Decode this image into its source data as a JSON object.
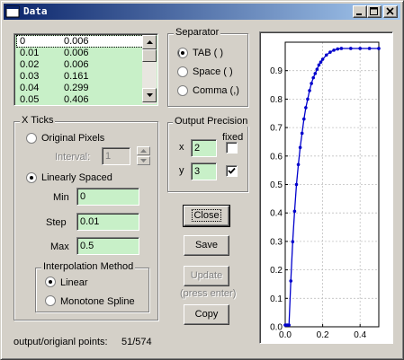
{
  "window": {
    "title": "Data"
  },
  "data_list": {
    "rows": [
      [
        "0",
        "0.006"
      ],
      [
        "0.01",
        "0.006"
      ],
      [
        "0.02",
        "0.006"
      ],
      [
        "0.03",
        "0.161"
      ],
      [
        "0.04",
        "0.299"
      ],
      [
        "0.05",
        "0.406"
      ]
    ]
  },
  "separator": {
    "title": "Separator",
    "options": [
      "TAB (    )",
      "Space ( )",
      "Comma (,)"
    ],
    "selected": 0
  },
  "xticks": {
    "title": "X Ticks",
    "original_label": "Original Pixels",
    "interval_label": "Interval:",
    "interval_value": "1",
    "linear_label": "Linearly Spaced",
    "min_label": "Min",
    "min_value": "0",
    "step_label": "Step",
    "step_value": "0.01",
    "max_label": "Max",
    "max_value": "0.5"
  },
  "interp": {
    "title": "Interpolation Method",
    "linear_label": "Linear",
    "spline_label": "Monotone Spline"
  },
  "precision": {
    "title": "Output Precision",
    "fixed_label": "fixed",
    "x_label": "x",
    "x_value": "2",
    "x_fixed": false,
    "y_label": "y",
    "y_value": "3",
    "y_fixed": true
  },
  "buttons": {
    "close": "Close",
    "save": "Save",
    "update": "Update",
    "update_hint": "(press enter)",
    "copy": "Copy"
  },
  "status": {
    "label": "output/origianl points:",
    "value": "51/574"
  },
  "colors": {
    "list_bg": "#c8f0c8",
    "curve": "#0000cc",
    "marker": "#0000cc"
  },
  "chart_data": {
    "type": "line",
    "xlim": [
      0,
      0.5
    ],
    "ylim": [
      0,
      1
    ],
    "xticks": [
      "0.0",
      "0.2",
      "0.4"
    ],
    "yticks": [
      "0.0",
      "0.1",
      "0.2",
      "0.3",
      "0.4",
      "0.5",
      "0.6",
      "0.7",
      "0.8",
      "0.9"
    ],
    "grid": true,
    "x": [
      0,
      0.01,
      0.02,
      0.03,
      0.04,
      0.05,
      0.06,
      0.07,
      0.08,
      0.09,
      0.1,
      0.11,
      0.12,
      0.13,
      0.14,
      0.15,
      0.16,
      0.17,
      0.18,
      0.19,
      0.2,
      0.22,
      0.24,
      0.26,
      0.28,
      0.3,
      0.35,
      0.4,
      0.45,
      0.5
    ],
    "y": [
      0.006,
      0.006,
      0.006,
      0.161,
      0.299,
      0.406,
      0.5,
      0.57,
      0.63,
      0.68,
      0.73,
      0.77,
      0.8,
      0.83,
      0.855,
      0.875,
      0.89,
      0.905,
      0.92,
      0.93,
      0.94,
      0.955,
      0.965,
      0.972,
      0.976,
      0.978,
      0.978,
      0.978,
      0.978,
      0.978
    ]
  }
}
